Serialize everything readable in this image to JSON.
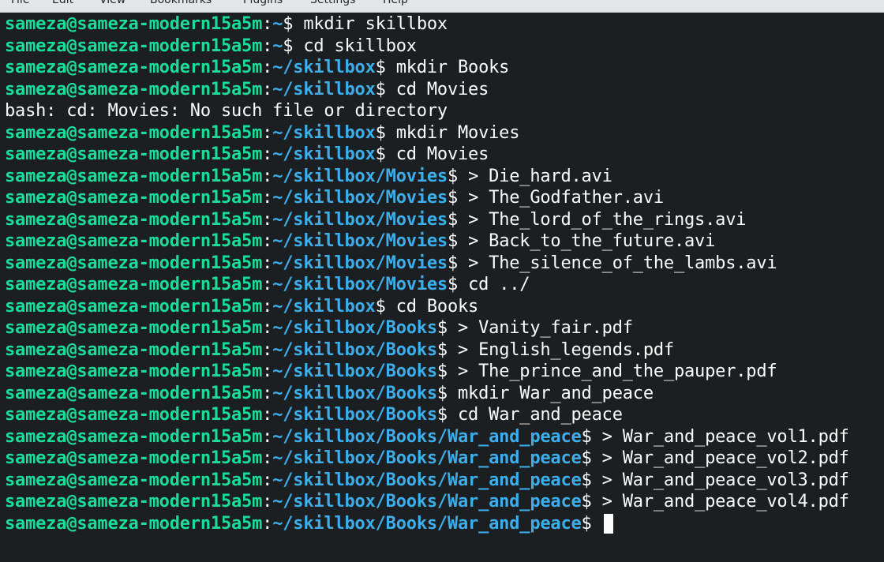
{
  "menu": {
    "items": [
      "File",
      "Edit",
      "View",
      "Bookmarks",
      "Plugins",
      "Settings",
      "Help"
    ]
  },
  "colors": {
    "background": "#1c1f22",
    "user_host": "#1cdc9a",
    "path": "#3daee9",
    "text": "#fcfcfc"
  },
  "terminal": {
    "user_host": "sameza@sameza-modern15a5m",
    "lines": [
      {
        "type": "prompt",
        "path": "~",
        "command": "mkdir skillbox"
      },
      {
        "type": "prompt",
        "path": "~",
        "command": "cd skillbox"
      },
      {
        "type": "prompt",
        "path": "~/skillbox",
        "command": "mkdir Books"
      },
      {
        "type": "prompt",
        "path": "~/skillbox",
        "command": "cd Movies"
      },
      {
        "type": "output",
        "text": "bash: cd: Movies: No such file or directory"
      },
      {
        "type": "prompt",
        "path": "~/skillbox",
        "command": "mkdir Movies"
      },
      {
        "type": "prompt",
        "path": "~/skillbox",
        "command": "cd Movies"
      },
      {
        "type": "prompt",
        "path": "~/skillbox/Movies",
        "command": "> Die_hard.avi"
      },
      {
        "type": "prompt",
        "path": "~/skillbox/Movies",
        "command": "> The_Godfather.avi"
      },
      {
        "type": "prompt",
        "path": "~/skillbox/Movies",
        "command": "> The_lord_of_the_rings.avi"
      },
      {
        "type": "prompt",
        "path": "~/skillbox/Movies",
        "command": "> Back_to_the_future.avi"
      },
      {
        "type": "prompt",
        "path": "~/skillbox/Movies",
        "command": "> The_silence_of_the_lambs.avi"
      },
      {
        "type": "prompt",
        "path": "~/skillbox/Movies",
        "command": "cd ../"
      },
      {
        "type": "prompt",
        "path": "~/skillbox",
        "command": "cd Books"
      },
      {
        "type": "prompt",
        "path": "~/skillbox/Books",
        "command": "> Vanity_fair.pdf"
      },
      {
        "type": "prompt",
        "path": "~/skillbox/Books",
        "command": "> English_legends.pdf"
      },
      {
        "type": "prompt",
        "path": "~/skillbox/Books",
        "command": "> The_prince_and_the_pauper.pdf"
      },
      {
        "type": "prompt",
        "path": "~/skillbox/Books",
        "command": "mkdir War_and_peace"
      },
      {
        "type": "prompt",
        "path": "~/skillbox/Books",
        "command": "cd War_and_peace"
      },
      {
        "type": "prompt",
        "path": "~/skillbox/Books/War_and_peace",
        "command": "> War_and_peace_vol1.pdf"
      },
      {
        "type": "prompt",
        "path": "~/skillbox/Books/War_and_peace",
        "command": "> War_and_peace_vol2.pdf"
      },
      {
        "type": "prompt",
        "path": "~/skillbox/Books/War_and_peace",
        "command": "> War_and_peace_vol3.pdf"
      },
      {
        "type": "prompt",
        "path": "~/skillbox/Books/War_and_peace",
        "command": "> War_and_peace_vol4.pdf"
      },
      {
        "type": "prompt",
        "path": "~/skillbox/Books/War_and_peace",
        "command": ""
      }
    ]
  }
}
